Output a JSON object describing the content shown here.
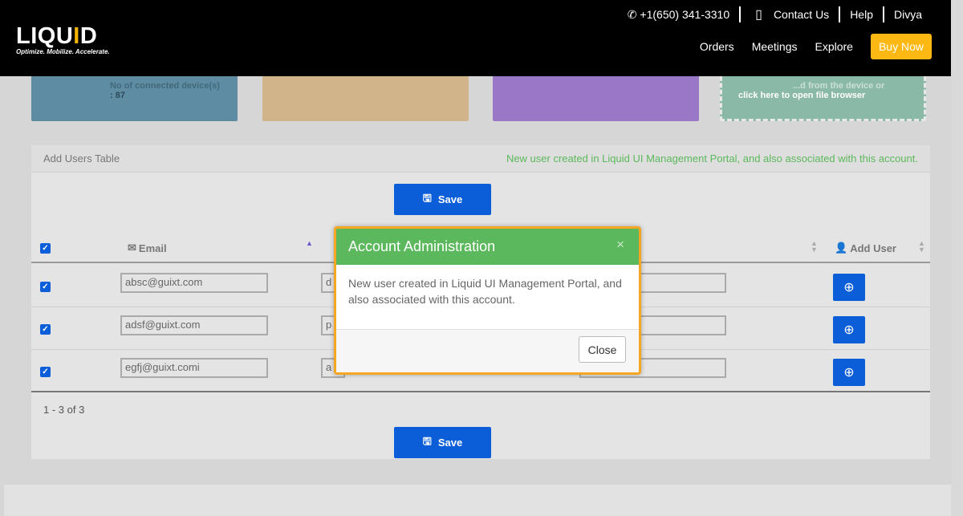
{
  "header": {
    "logo_main": "LIQU",
    "logo_i": "I",
    "logo_end": "D",
    "logo_tagline": "Optimize. Mobilize. Accelerate.",
    "phone": "+1(650) 341-3310",
    "contact": "Contact Us",
    "help": "Help",
    "user": "Divya",
    "nav": [
      "Orders",
      "Meetings",
      "Explore"
    ],
    "buy_now": "Buy Now",
    "accent_color": "#fdb813"
  },
  "cards": {
    "card1_line1": "No of connected device(s)",
    "card1_line2": ": 87",
    "card4_line1": "...d from the device or",
    "card4_line2": "click here to open file browser"
  },
  "panel": {
    "title": "Add Users Table",
    "message": "New user created in Liquid UI Management Portal, and also associated with this account.",
    "save_label": "Save",
    "columns": {
      "email": "Email",
      "add_user": "Add User"
    },
    "rows": [
      {
        "email": "absc@guixt.com",
        "col2": "d",
        "checked": true
      },
      {
        "email": "adsf@guixt.com",
        "col2": "p",
        "checked": true
      },
      {
        "email": "egfj@guixt.comi",
        "col2": "a",
        "checked": true
      }
    ],
    "pager": "1 - 3 of 3"
  },
  "modal": {
    "title": "Account Administration",
    "close_x": "×",
    "body": "New user created in Liquid UI Management Portal, and also associated with this account.",
    "close_label": "Close",
    "header_color": "#5cb85c",
    "border_color": "#f5a623"
  }
}
